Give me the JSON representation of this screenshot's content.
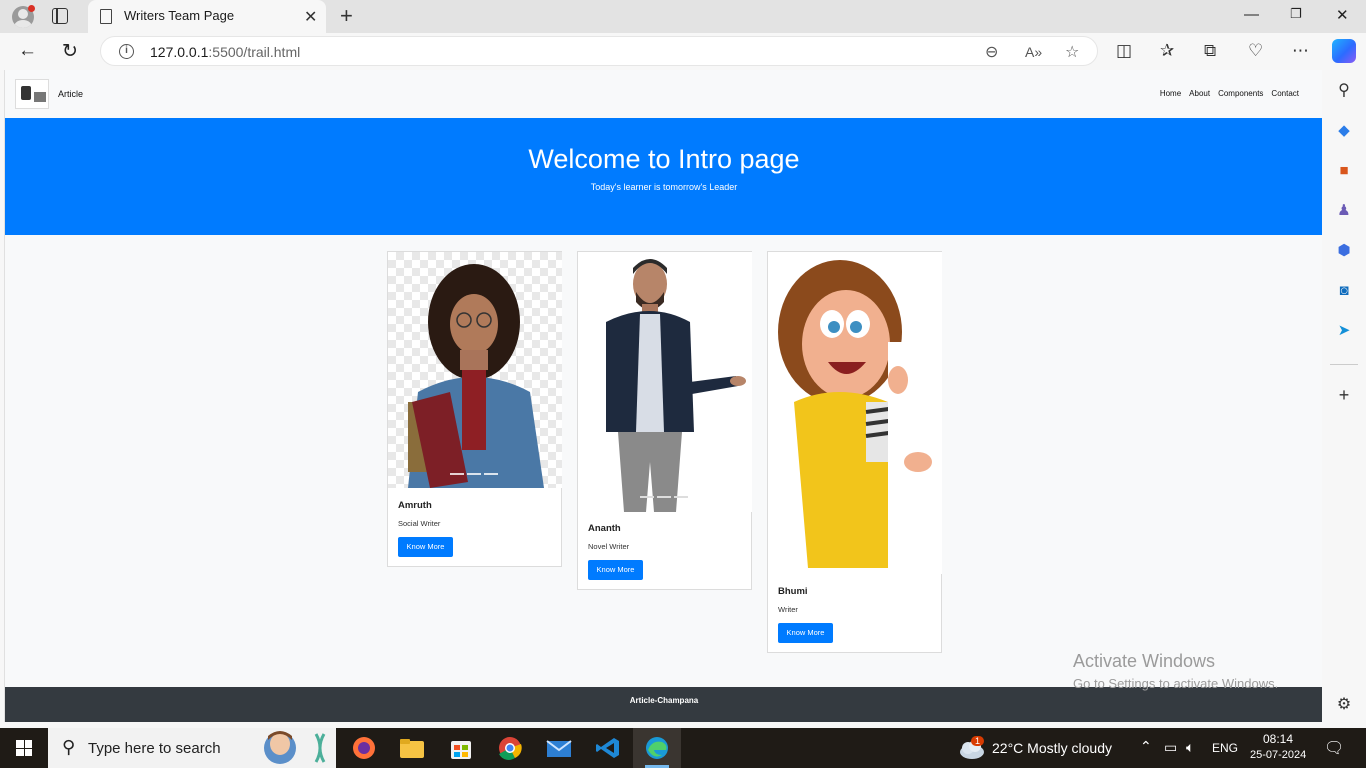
{
  "browser": {
    "tab_title": "Writers Team Page",
    "url_host": "127.0.0.1",
    "url_path": ":5500/trail.html"
  },
  "site": {
    "brand": "Article",
    "nav": [
      "Home",
      "About",
      "Components",
      "Contact"
    ],
    "hero_title": "Welcome to Intro page",
    "hero_subtitle": "Today's learner is tomorrow's Leader",
    "cards": [
      {
        "name": "Amruth",
        "role": "Social Writer",
        "button": "Know More"
      },
      {
        "name": "Ananth",
        "role": "Novel Writer",
        "button": "Know More"
      },
      {
        "name": "Bhumi",
        "role": "Writer",
        "button": "Know More"
      }
    ],
    "footer": "Article-Champana"
  },
  "watermark": {
    "line1": "Activate Windows",
    "line2": "Go to Settings to activate Windows."
  },
  "taskbar": {
    "search_placeholder": "Type here to search",
    "weather": "22°C  Mostly cloudy",
    "weather_badge": "1",
    "language": "ENG",
    "time": "08:14",
    "date": "25-07-2024"
  },
  "colors": {
    "primary": "#007bff",
    "footer": "#343a40",
    "taskbar": "#1f1b16"
  }
}
